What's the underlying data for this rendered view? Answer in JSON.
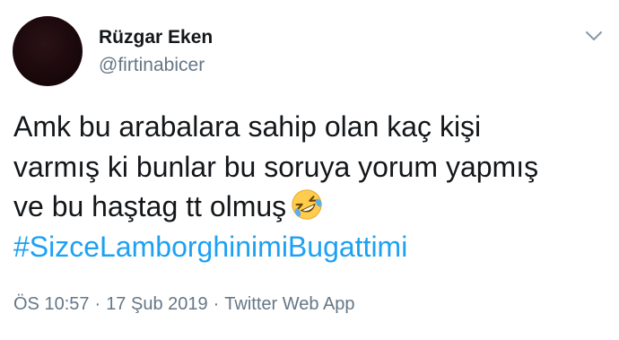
{
  "author": {
    "name": "Rüzgar Eken",
    "handle": "@firtinabicer"
  },
  "icons": {
    "caret": "chevron-down-icon",
    "emoji": "rolling-on-the-floor-laughing-emoji-icon"
  },
  "tweet": {
    "lines": [
      "Amk bu arabalara sahip olan kaç kişi",
      "varmış ki bunlar bu soruya yorum yapmış",
      "ve bu haştag tt olmuş"
    ],
    "hashtag": "#SizceLamborghinimiBugattimi"
  },
  "meta": {
    "time": "ÖS 10:57",
    "separator": "·",
    "date": "17 Şub 2019",
    "source": "Twitter Web App"
  },
  "colors": {
    "link": "#1da1f2",
    "secondary_text": "#657786",
    "primary_text": "#14171a"
  }
}
